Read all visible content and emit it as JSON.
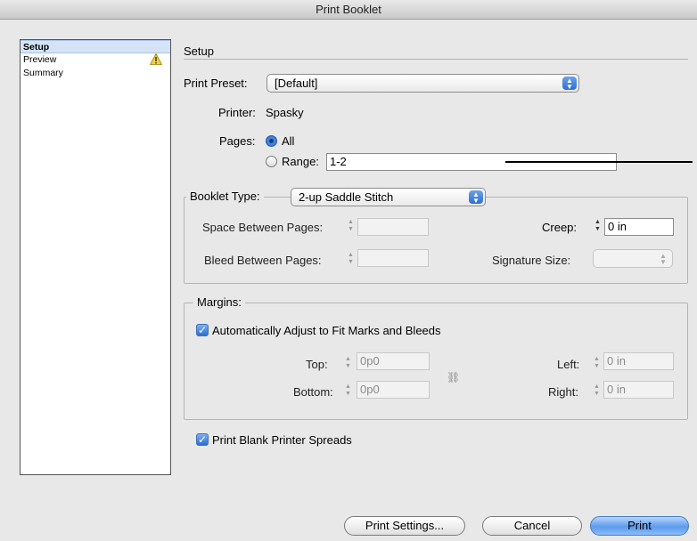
{
  "window": {
    "title": "Print Booklet"
  },
  "sidebar": {
    "items": [
      {
        "label": "Setup",
        "selected": true
      },
      {
        "label": "Preview",
        "warning": true
      },
      {
        "label": "Summary"
      }
    ]
  },
  "setup": {
    "section_title": "Setup",
    "print_preset": {
      "label": "Print Preset:",
      "value": "[Default]"
    },
    "printer": {
      "label": "Printer:",
      "value": "Spasky"
    },
    "pages": {
      "label": "Pages:",
      "all_label": "All",
      "range_label": "Range:",
      "range_value": "1-2",
      "selected": "All"
    },
    "booklet": {
      "label": "Booklet Type:",
      "value": "2-up Saddle Stitch",
      "space_between_label": "Space Between Pages:",
      "space_between_value": "",
      "bleed_between_label": "Bleed Between Pages:",
      "bleed_between_value": "",
      "creep_label": "Creep:",
      "creep_value": "0 in",
      "signature_label": "Signature Size:",
      "signature_value": ""
    },
    "margins": {
      "label": "Margins:",
      "auto_adjust_label": "Automatically Adjust to Fit Marks and Bleeds",
      "auto_adjust_checked": true,
      "top_label": "Top:",
      "top_value": "0p0",
      "bottom_label": "Bottom:",
      "bottom_value": "0p0",
      "left_label": "Left:",
      "left_value": "0 in",
      "right_label": "Right:",
      "right_value": "0 in"
    },
    "blank_spreads": {
      "label": "Print Blank Printer Spreads",
      "checked": true
    }
  },
  "buttons": {
    "print_settings": "Print Settings...",
    "cancel": "Cancel",
    "print": "Print"
  },
  "colors": {
    "accent": "#2c6fd4",
    "selection": "#d5e3f6"
  }
}
